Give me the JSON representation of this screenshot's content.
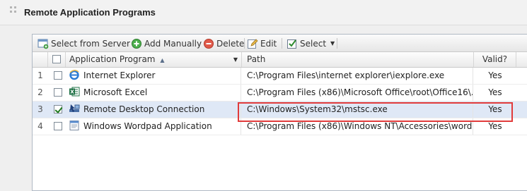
{
  "panel": {
    "title": "Remote Application Programs"
  },
  "toolbar": {
    "select_from_server": "Select from Server",
    "add_manually": "Add Manually",
    "delete": "Delete",
    "edit": "Edit",
    "select": "Select"
  },
  "columns": {
    "application_program": "Application Program",
    "path": "Path",
    "valid": "Valid?"
  },
  "rows": [
    {
      "num": "1",
      "checked": false,
      "icon": "internet-explorer-icon",
      "name": "Internet Explorer",
      "path": "C:\\Program Files\\internet explorer\\iexplore.exe",
      "valid": "Yes"
    },
    {
      "num": "2",
      "checked": false,
      "icon": "excel-icon",
      "name": "Microsoft Excel",
      "path": "C:\\Program Files (x86)\\Microsoft Office\\root\\Office16\\...",
      "valid": "Yes"
    },
    {
      "num": "3",
      "checked": true,
      "icon": "remote-desktop-icon",
      "name": "Remote Desktop Connection",
      "path": "C:\\Windows\\System32\\mstsc.exe",
      "valid": "Yes"
    },
    {
      "num": "4",
      "checked": false,
      "icon": "wordpad-icon",
      "name": "Windows Wordpad Application",
      "path": "C:\\Program Files (x86)\\Windows NT\\Accessories\\word...",
      "valid": "Yes"
    }
  ],
  "colors": {
    "selected_row": "#dfe8f6",
    "highlight": "#e13b3b"
  }
}
